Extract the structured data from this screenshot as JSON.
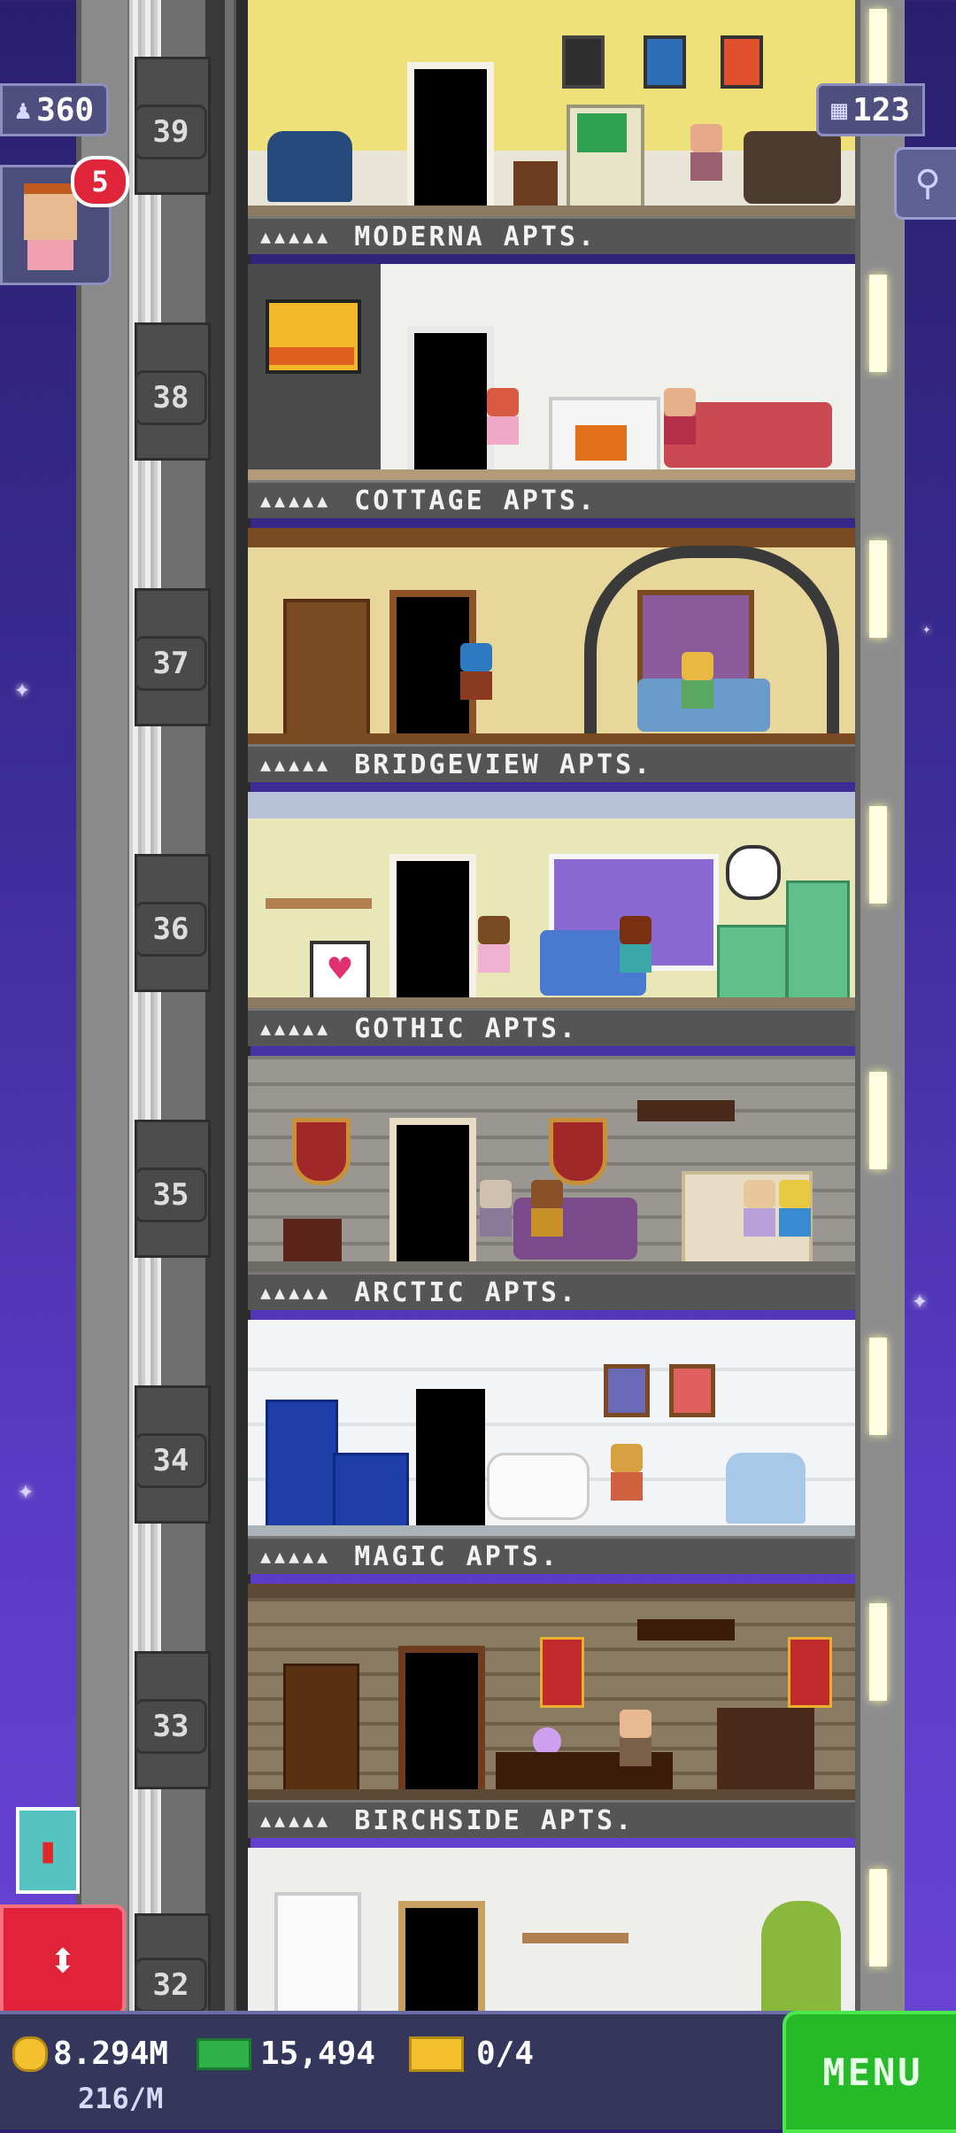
{
  "hud": {
    "population": "360",
    "floors": "123",
    "visitor_count": "5"
  },
  "floors": [
    {
      "number": "39",
      "name": "MODERNA APTS.",
      "stars": "▲▲▲▲▲",
      "wall": "#efe17a",
      "trim": "#c9c0a2",
      "ground": "#8c7b62"
    },
    {
      "number": "38",
      "name": "COTTAGE APTS.",
      "stars": "▲▲▲▲▲",
      "wall": "#f0f0ec",
      "trim": "#cfcfcf",
      "ground": "#b49a78"
    },
    {
      "number": "37",
      "name": "BRIDGEVIEW APTS.",
      "stars": "▲▲▲▲▲",
      "wall": "#e8d79a",
      "trim": "#7a4a22",
      "ground": "#7a4a22"
    },
    {
      "number": "36",
      "name": "GOTHIC APTS.",
      "stars": "▲▲▲▲▲",
      "wall": "#e9e7b8",
      "trim": "#b7c2d8",
      "ground": "#8c7b62"
    },
    {
      "number": "35",
      "name": "ARCTIC APTS.",
      "stars": "▲▲▲▲▲",
      "wall": "#9a9792",
      "trim": "#6e6b66",
      "ground": "#6e6b66"
    },
    {
      "number": "34",
      "name": "MAGIC APTS.",
      "stars": "▲▲▲▲▲",
      "wall": "#f2f4f5",
      "trim": "#d9dde0",
      "ground": "#a9b3b8"
    },
    {
      "number": "33",
      "name": "BIRCHSIDE APTS.",
      "stars": "▲▲▲▲▲",
      "wall": "#8b7a62",
      "trim": "#5e4a34",
      "ground": "#5e4a34"
    },
    {
      "number": "32",
      "name": "",
      "stars": "",
      "wall": "#eeeeec",
      "trim": "#cfcfcf",
      "ground": "#b7b7b7"
    }
  ],
  "bottom_bar": {
    "coins": "8.294M",
    "coins_rate": "216/M",
    "bux": "15,494",
    "tickets": "0/4",
    "menu_label": "MENU"
  },
  "colors": {
    "sky": "#3b2b94",
    "menu_green": "#26b928",
    "elevator_red": "#e0223a",
    "badge_red": "#e0243a"
  }
}
